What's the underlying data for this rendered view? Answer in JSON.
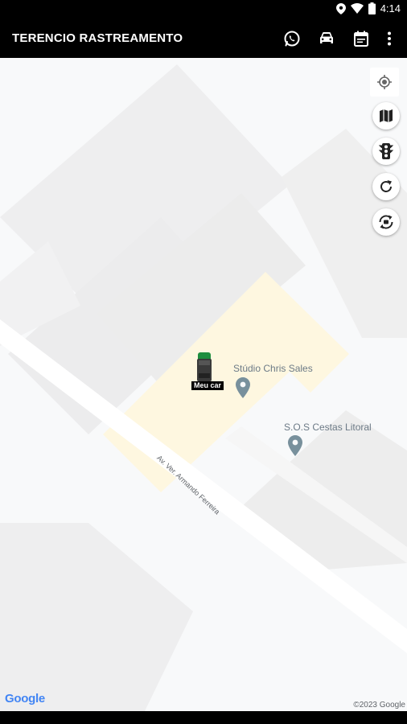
{
  "status_bar": {
    "time": "4:14"
  },
  "app_bar": {
    "title": "TERENCIO RASTREAMENTO",
    "actions": [
      "whatsapp-icon",
      "car-icon",
      "calendar-icon",
      "more-vert-icon"
    ]
  },
  "map": {
    "controls": [
      "my-location-icon",
      "map-layers-icon",
      "traffic-light-icon",
      "refresh-icon",
      "rotate-camera-icon"
    ],
    "vehicle": {
      "label": "Meu car",
      "color": "#1e8e3e"
    },
    "pois": [
      {
        "name": "Stúdio Chris Sales"
      },
      {
        "name": "S.O.S Cestas Litoral"
      }
    ],
    "street_name": "Av. Ver. Armando Ferreira",
    "attribution": {
      "logo": "Google",
      "copyright": "©2023 Google"
    }
  },
  "colors": {
    "app_bar": "#000000",
    "map_bg": "#f8f9fa",
    "building": "#ebebeb",
    "highlight_area": "#fef7e0",
    "poi": "#78909c"
  }
}
